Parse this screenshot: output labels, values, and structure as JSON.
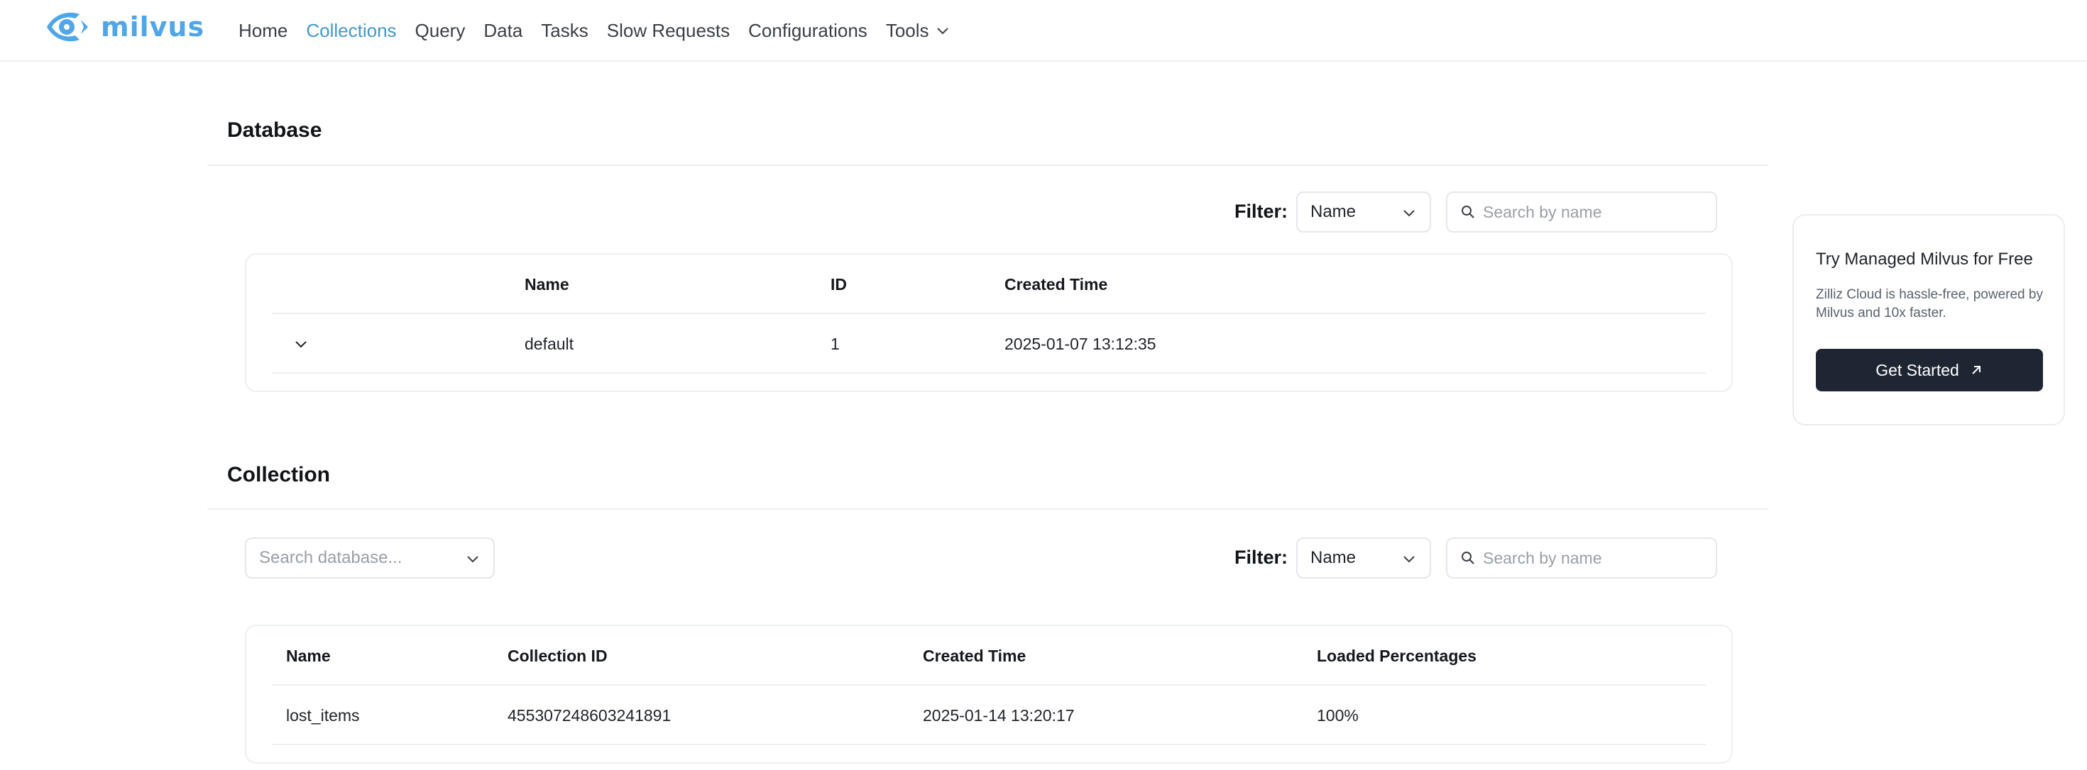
{
  "app": {
    "logo_text": "milvus",
    "brand_color": "#4fa6e8"
  },
  "nav": {
    "items": [
      {
        "label": "Home",
        "active": false
      },
      {
        "label": "Collections",
        "active": true
      },
      {
        "label": "Query",
        "active": false
      },
      {
        "label": "Data",
        "active": false
      },
      {
        "label": "Tasks",
        "active": false
      },
      {
        "label": "Slow Requests",
        "active": false
      },
      {
        "label": "Configurations",
        "active": false
      },
      {
        "label": "Tools",
        "active": false,
        "icon": "chevron-down-icon"
      }
    ],
    "active_color": "#4397cf"
  },
  "database": {
    "title": "Database",
    "filter_label": "Filter:",
    "filter_value": "Name",
    "search_placeholder": "Search by name",
    "columns": [
      "Name",
      "ID",
      "Created Time"
    ],
    "rows": [
      {
        "expand_icon": "chevron-down-icon",
        "name": "default",
        "id": "1",
        "created_time": "2025-01-07 13:12:35"
      }
    ]
  },
  "collection": {
    "title": "Collection",
    "database_select_placeholder": "Search database...",
    "filter_label": "Filter:",
    "filter_value": "Name",
    "search_placeholder": "Search by name",
    "columns": [
      "Name",
      "Collection ID",
      "Created Time",
      "Loaded Percentages"
    ],
    "rows": [
      {
        "name": "lost_items",
        "collection_id": "455307248603241891",
        "created_time": "2025-01-14 13:20:17",
        "loaded_percentage": "100%"
      }
    ]
  },
  "promo": {
    "title": "Try Managed Milvus for Free",
    "description": "Zilliz Cloud is hassle-free, powered by Milvus and 10x faster.",
    "button_label": "Get Started",
    "button_icon": "arrow-up-right-icon",
    "button_color": "#1f2633"
  }
}
